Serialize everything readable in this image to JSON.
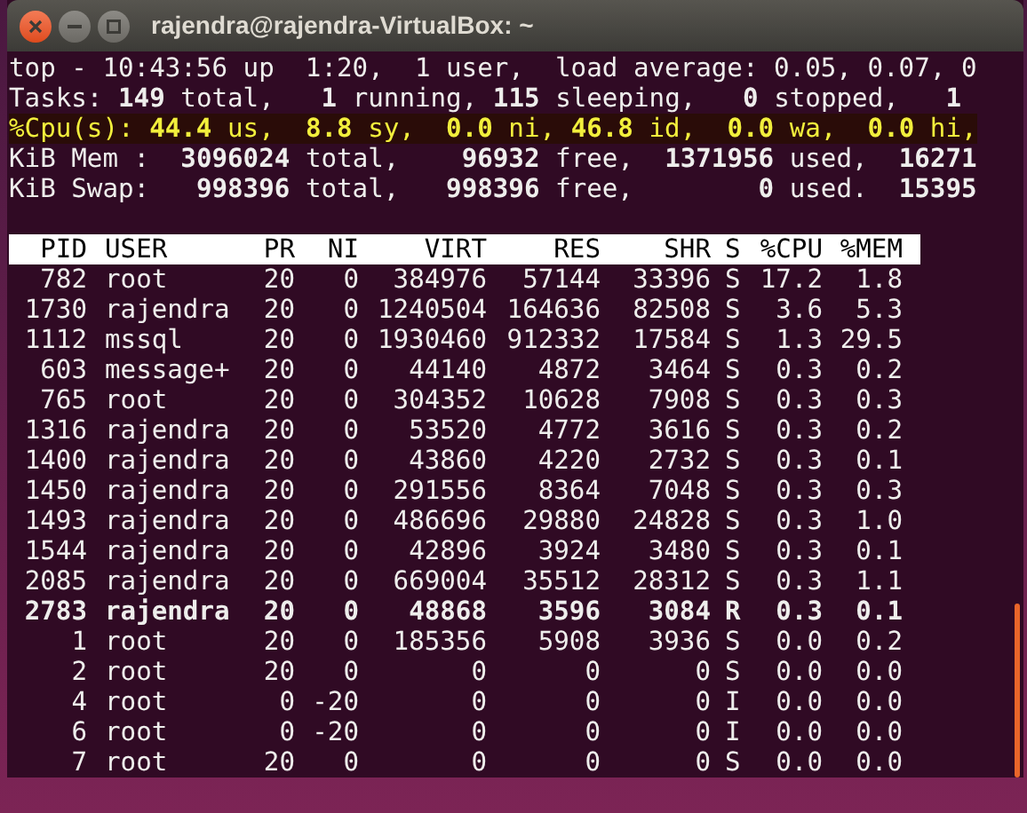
{
  "window": {
    "title": "rajendra@rajendra-VirtualBox: ~"
  },
  "summary": [
    {
      "kind": "plain",
      "text": "top - 10:43:56 up  1:20,  1 user,  load average: 0.05, 0.07, 0"
    },
    {
      "kind": "plain",
      "text": "Tasks: **149** total,   **1** running, **115** sleeping,   **0** stopped,   **1**"
    },
    {
      "kind": "highlight",
      "text": "%Cpu(s): **44.4** us,  **8.8** sy,  **0.0** ni, **46.8** id,  **0.0** wa,  **0.0** hi,"
    },
    {
      "kind": "plain",
      "text": "KiB Mem :  **3096024** total,    **96932** free,  **1371956** used,  **16271**"
    },
    {
      "kind": "plain",
      "text": "KiB Swap:   **998396** total,   **998396** free,        **0** used.  **15395**"
    }
  ],
  "table": {
    "columns": [
      "PID",
      "USER",
      "PR",
      "NI",
      "VIRT",
      "RES",
      "SHR",
      "S",
      "%CPU",
      "%MEM"
    ],
    "rows": [
      {
        "bold": false,
        "cells": [
          "782",
          "root",
          "20",
          "0",
          "384976",
          "57144",
          "33396",
          "S",
          "17.2",
          "1.8"
        ]
      },
      {
        "bold": false,
        "cells": [
          "1730",
          "rajendra",
          "20",
          "0",
          "1240504",
          "164636",
          "82508",
          "S",
          "3.6",
          "5.3"
        ]
      },
      {
        "bold": false,
        "cells": [
          "1112",
          "mssql",
          "20",
          "0",
          "1930460",
          "912332",
          "17584",
          "S",
          "1.3",
          "29.5"
        ]
      },
      {
        "bold": false,
        "cells": [
          "603",
          "message+",
          "20",
          "0",
          "44140",
          "4872",
          "3464",
          "S",
          "0.3",
          "0.2"
        ]
      },
      {
        "bold": false,
        "cells": [
          "765",
          "root",
          "20",
          "0",
          "304352",
          "10628",
          "7908",
          "S",
          "0.3",
          "0.3"
        ]
      },
      {
        "bold": false,
        "cells": [
          "1316",
          "rajendra",
          "20",
          "0",
          "53520",
          "4772",
          "3616",
          "S",
          "0.3",
          "0.2"
        ]
      },
      {
        "bold": false,
        "cells": [
          "1400",
          "rajendra",
          "20",
          "0",
          "43860",
          "4220",
          "2732",
          "S",
          "0.3",
          "0.1"
        ]
      },
      {
        "bold": false,
        "cells": [
          "1450",
          "rajendra",
          "20",
          "0",
          "291556",
          "8364",
          "7048",
          "S",
          "0.3",
          "0.3"
        ]
      },
      {
        "bold": false,
        "cells": [
          "1493",
          "rajendra",
          "20",
          "0",
          "486696",
          "29880",
          "24828",
          "S",
          "0.3",
          "1.0"
        ]
      },
      {
        "bold": false,
        "cells": [
          "1544",
          "rajendra",
          "20",
          "0",
          "42896",
          "3924",
          "3480",
          "S",
          "0.3",
          "0.1"
        ]
      },
      {
        "bold": false,
        "cells": [
          "2085",
          "rajendra",
          "20",
          "0",
          "669004",
          "35512",
          "28312",
          "S",
          "0.3",
          "1.1"
        ]
      },
      {
        "bold": true,
        "cells": [
          "2783",
          "rajendra",
          "20",
          "0",
          "48868",
          "3596",
          "3084",
          "R",
          "0.3",
          "0.1"
        ]
      },
      {
        "bold": false,
        "cells": [
          "1",
          "root",
          "20",
          "0",
          "185356",
          "5908",
          "3936",
          "S",
          "0.0",
          "0.2"
        ]
      },
      {
        "bold": false,
        "cells": [
          "2",
          "root",
          "20",
          "0",
          "0",
          "0",
          "0",
          "S",
          "0.0",
          "0.0"
        ]
      },
      {
        "bold": false,
        "cells": [
          "4",
          "root",
          "0",
          "-20",
          "0",
          "0",
          "0",
          "I",
          "0.0",
          "0.0"
        ]
      },
      {
        "bold": false,
        "cells": [
          "6",
          "root",
          "0",
          "-20",
          "0",
          "0",
          "0",
          "I",
          "0.0",
          "0.0"
        ]
      },
      {
        "bold": false,
        "cells": [
          "7",
          "root",
          "20",
          "0",
          "0",
          "0",
          "0",
          "S",
          "0.0",
          "0.0"
        ]
      }
    ]
  }
}
